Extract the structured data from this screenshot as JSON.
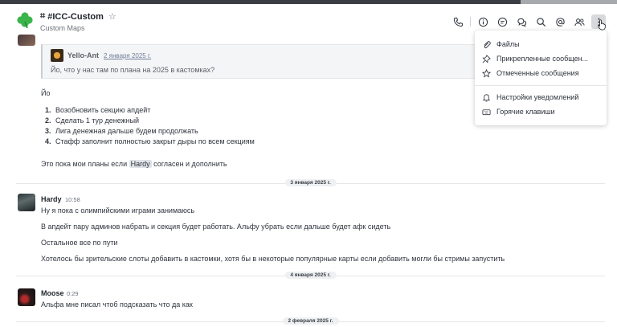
{
  "header": {
    "room_name": "#ICC-Custom",
    "topic": "Custom Maps",
    "toolbar": [
      "call-icon",
      "info-icon",
      "threads-icon",
      "discussion-icon",
      "search-icon",
      "mention-icon",
      "members-icon",
      "kebab-icon"
    ]
  },
  "quote": {
    "author": "Yello-Ant",
    "date": "2 января 2025 г.",
    "text": "Йо, что у нас там по плана на 2025 в кастомках?"
  },
  "msg1": {
    "greeting": "Йо",
    "list": [
      {
        "num": "1.",
        "text": "Возобновить секцию апдейт"
      },
      {
        "num": "2.",
        "text": "Сделать 1 тур денежный"
      },
      {
        "num": "3.",
        "text": "Лига денежная дальше будем продолжать"
      },
      {
        "num": "4.",
        "text": "Стафф заполнит полностью закрыт дыры по всем секциям"
      }
    ],
    "closing_before": "Это пока мои планы если ",
    "mention": "Hardy",
    "closing_after": " согласен и дополнить"
  },
  "dividers": {
    "d1": "3 января 2025 г.",
    "d2": "4 января 2025 г.",
    "d3": "2 февраля 2025 г."
  },
  "msg2": {
    "author": "Hardy",
    "time": "10:58",
    "lines": [
      "Ну я пока с олимпийскими играми занимаюсь",
      "В апдейт пару админов набрать и секция будет работать. Альфу убрать если дальше будет афк сидеть",
      "Остальное все по пути",
      "Хотелось бы зрительские слоты добавить в кастомки, хотя бы в некоторые популярные карты если добавить могли бы стримы запустить"
    ]
  },
  "msg3": {
    "author": "Moose",
    "time": "0:29",
    "text": "Альфа мне писал чтоб подсказать что да как"
  },
  "menu": {
    "files": "Файлы",
    "pinned": "Прикрепленные сообщен...",
    "starred": "Отмеченные сообщения",
    "notifications": "Настройки уведомлений",
    "shortcuts": "Горячие клавиши"
  },
  "colors": {
    "accent_logo": "#3ab54a",
    "text": "#2f343d",
    "muted": "#6c727a"
  }
}
